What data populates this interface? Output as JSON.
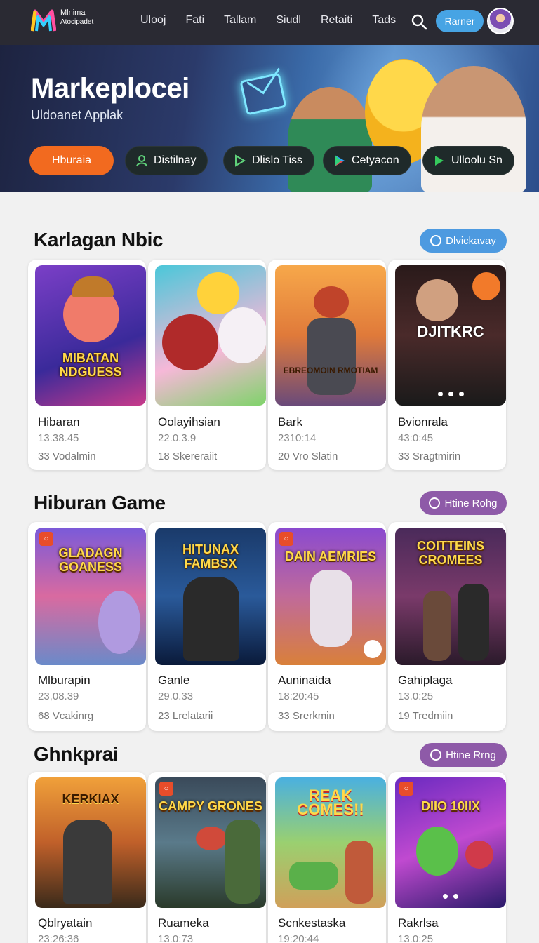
{
  "nav": {
    "brand_line1": "Mlnima",
    "brand_line2": "Atocipadet",
    "links": [
      "Ulooj",
      "Fati",
      "Tallam",
      "Siudl",
      "Retaiti",
      "Tads"
    ],
    "button": "Rarner"
  },
  "hero": {
    "title": "Markeplocei",
    "subtitle": "Uldoanet Applak",
    "primary_button": "Hburaia",
    "buttons": [
      "Distilnay",
      "Dlislo Tiss",
      "Cetyacon",
      "Ulloolu Sn"
    ]
  },
  "sections": [
    {
      "title": "Karlagan Nbic",
      "pill": "Dlvickavay",
      "cards": [
        {
          "thumb_text": "MIBATAN NDGUESS",
          "name": "Hibaran",
          "meta": "13.38.45",
          "sub": "33 Vodalmin"
        },
        {
          "thumb_text": "",
          "name": "Oolayihsian",
          "meta": "22.0.3.9",
          "sub": "18 Skereraiit"
        },
        {
          "thumb_text": "EBREOMOIN RMOTIAM",
          "name": "Bark",
          "meta": "2310:14",
          "sub": "20 Vro Slatin"
        },
        {
          "thumb_text": "DJITKRC",
          "name": "Bvionrala",
          "meta": "43:0:45",
          "sub": "33 Sragtmirin"
        }
      ]
    },
    {
      "title": "Hiburan Game",
      "pill": "Htine Rohg",
      "cards": [
        {
          "thumb_text": "GLADAGN GOANESS",
          "name": "Mlburapin",
          "meta": "23,08.39",
          "sub": "68 Vcakinrg"
        },
        {
          "thumb_text": "HITUNAX FAMBSX",
          "name": "Ganle",
          "meta": "29.0.33",
          "sub": "23 Lrelatarii"
        },
        {
          "thumb_text": "DAIN AEMRIES",
          "name": "Auninaida",
          "meta": "18:20:45",
          "sub": "33 Srerkmin"
        },
        {
          "thumb_text": "COITTEINS CROMEES",
          "name": "Gahiplaga",
          "meta": "13.0:25",
          "sub": "19 Tredmiin"
        }
      ]
    },
    {
      "title": "Ghnkprai",
      "pill": "Htine Rrng",
      "cards": [
        {
          "thumb_text": "KERKIAX",
          "name": "Qblryatain",
          "meta": "23:26:36",
          "sub": ""
        },
        {
          "thumb_text": "CAMPY GRONES",
          "name": "Ruameka",
          "meta": "13.0:73",
          "sub": ""
        },
        {
          "thumb_text": "REAK COMES!!",
          "name": "Scnkestaska",
          "meta": "19:20:44",
          "sub": ""
        },
        {
          "thumb_text": "DIIO 10IIX",
          "name": "Rakrlsa",
          "meta": "13.0:25",
          "sub": ""
        }
      ]
    }
  ]
}
